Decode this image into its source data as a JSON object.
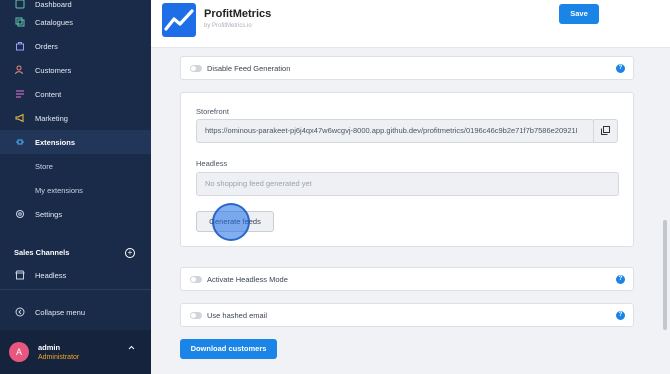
{
  "sidebar": {
    "items": [
      {
        "label": "Dashboard",
        "icon": "dashboard-icon"
      },
      {
        "label": "Catalogues",
        "icon": "catalogue-icon"
      },
      {
        "label": "Orders",
        "icon": "orders-icon"
      },
      {
        "label": "Customers",
        "icon": "customers-icon"
      },
      {
        "label": "Content",
        "icon": "content-icon"
      },
      {
        "label": "Marketing",
        "icon": "megaphone-icon"
      },
      {
        "label": "Extensions",
        "icon": "extensions-icon"
      },
      {
        "label": "Store"
      },
      {
        "label": "My extensions"
      },
      {
        "label": "Settings",
        "icon": "gear-icon"
      }
    ],
    "sales_channels_title": "Sales Channels",
    "channel_headless": "Headless",
    "collapse_label": "Collapse menu",
    "user": {
      "initial": "A",
      "name": "admin",
      "role": "Administrator"
    }
  },
  "header": {
    "app_title": "ProfitMetrics",
    "app_subtitle": "by ProfitMetrics.io",
    "save_label": "Save"
  },
  "main": {
    "disable_feed_label": "Disable Feed Generation",
    "storefront_label": "Storefront",
    "storefront_value": "https://ominous-parakeet-pj6j4qx47w6wcgvj-8000.app.github.dev/profitmetrics/0196c46c9b2e71f7b7586e20921I",
    "headless_label": "Headless",
    "headless_placeholder": "No shopping feed generated yet",
    "generate_label": "Generate feeds",
    "activate_headless_label": "Activate Headless Mode",
    "hashed_email_label": "Use hashed email",
    "download_label": "Download customers"
  },
  "colors": {
    "sidebar_bg": "#1a2b4a",
    "primary": "#1b84e7",
    "role_accent": "#f5a623",
    "avatar": "#e8577e"
  }
}
